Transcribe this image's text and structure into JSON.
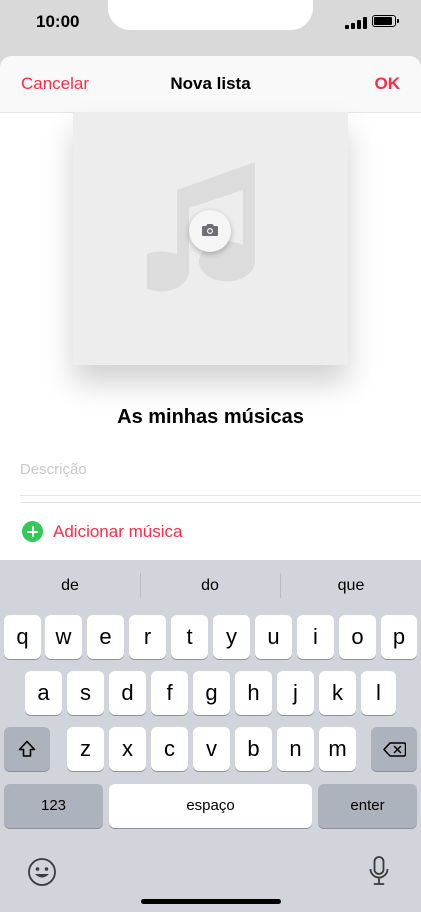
{
  "status_bar": {
    "time": "10:00"
  },
  "nav": {
    "cancel_label": "Cancelar",
    "title": "Nova lista",
    "ok_label": "OK"
  },
  "playlist": {
    "name": "As minhas músicas",
    "description_placeholder": "Descrição",
    "add_music_label": "Adicionar música"
  },
  "keyboard": {
    "suggestions": [
      "de",
      "do",
      "que"
    ],
    "row1": [
      "q",
      "w",
      "e",
      "r",
      "t",
      "y",
      "u",
      "i",
      "o",
      "p"
    ],
    "row2": [
      "a",
      "s",
      "d",
      "f",
      "g",
      "h",
      "j",
      "k",
      "l"
    ],
    "row3": [
      "z",
      "x",
      "c",
      "v",
      "b",
      "n",
      "m"
    ],
    "numbers_label": "123",
    "space_label": "espaço",
    "enter_label": "enter"
  },
  "colors": {
    "accent": "#fa2d48",
    "add_green": "#34c759"
  },
  "icons": [
    "signal-icon",
    "battery-icon",
    "music-note-icon",
    "camera-icon",
    "plus-icon",
    "shift-icon",
    "delete-icon",
    "emoji-icon",
    "mic-icon"
  ]
}
